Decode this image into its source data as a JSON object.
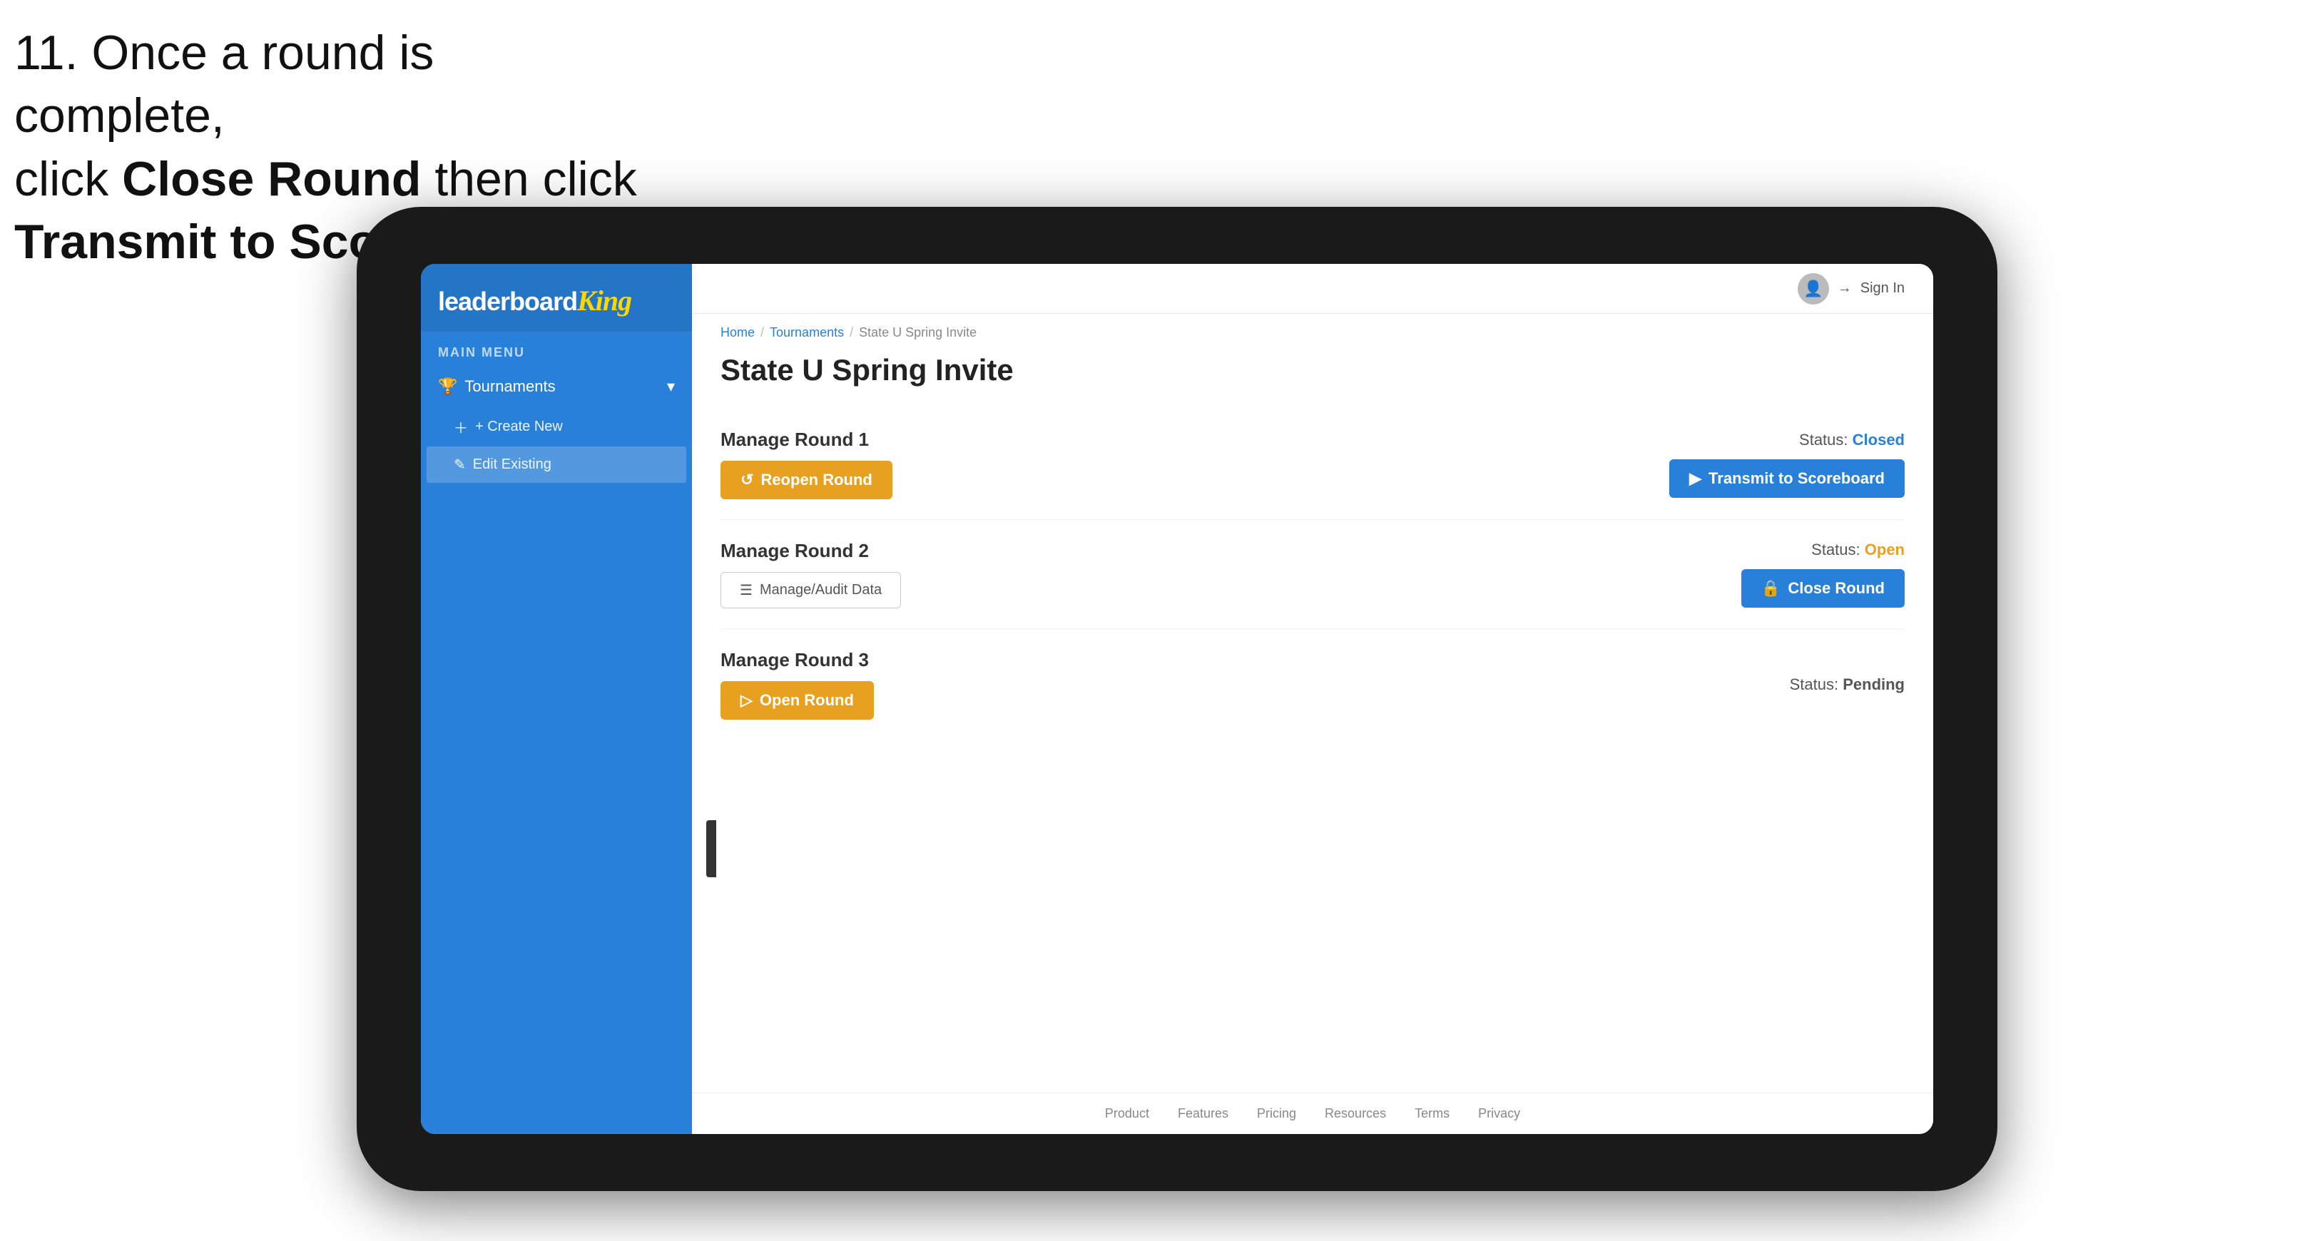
{
  "instruction": {
    "line1": "11. Once a round is complete,",
    "line2": "click ",
    "bold1": "Close Round",
    "line3": " then click",
    "bold2": "Transmit to Scoreboard."
  },
  "breadcrumb": {
    "home": "Home",
    "sep1": "/",
    "tournaments": "Tournaments",
    "sep2": "/",
    "current": "State U Spring Invite"
  },
  "page": {
    "title": "State U Spring Invite"
  },
  "sidebar": {
    "logo": "leaderboard",
    "logo_brand": "King",
    "main_menu_label": "MAIN MENU",
    "tournaments_label": "Tournaments",
    "create_new_label": "+ Create New",
    "edit_existing_label": "Edit Existing"
  },
  "topnav": {
    "sign_in": "Sign In"
  },
  "rounds": [
    {
      "title": "Manage Round 1",
      "status_label": "Status:",
      "status_value": "Closed",
      "status_class": "closed",
      "button1_label": "Reopen Round",
      "button1_type": "yellow",
      "button2_label": "Transmit to Scoreboard",
      "button2_type": "blue"
    },
    {
      "title": "Manage Round 2",
      "status_label": "Status:",
      "status_value": "Open",
      "status_class": "open",
      "button1_label": "Manage/Audit Data",
      "button1_type": "outline",
      "button2_label": "Close Round",
      "button2_type": "blue"
    },
    {
      "title": "Manage Round 3",
      "status_label": "Status:",
      "status_value": "Pending",
      "status_class": "pending",
      "button1_label": "Open Round",
      "button1_type": "yellow",
      "button2_label": null
    }
  ],
  "footer": {
    "links": [
      "Product",
      "Features",
      "Pricing",
      "Resources",
      "Terms",
      "Privacy"
    ]
  }
}
